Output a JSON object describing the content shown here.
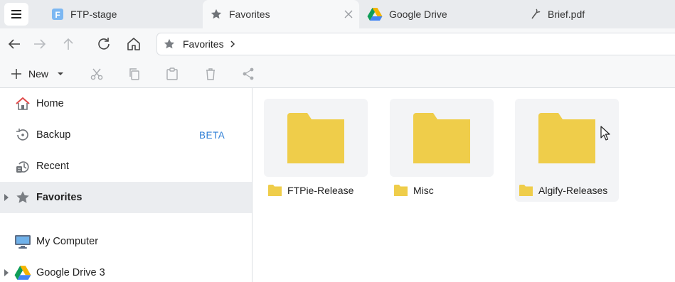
{
  "tabs": [
    {
      "label": "FTP-stage",
      "icon": "ftp-app-icon"
    },
    {
      "label": "Favorites",
      "icon": "star-icon",
      "active": true
    },
    {
      "label": "Google Drive",
      "icon": "google-drive-icon"
    },
    {
      "label": "Brief.pdf",
      "icon": "pdf-link-icon"
    }
  ],
  "address": {
    "path": [
      "Favorites"
    ]
  },
  "toolbar": {
    "new_label": "New"
  },
  "sidebar": {
    "items": [
      {
        "label": "Home",
        "icon": "home-icon"
      },
      {
        "label": "Backup",
        "icon": "backup-icon",
        "badge": "BETA"
      },
      {
        "label": "Recent",
        "icon": "recent-icon"
      },
      {
        "label": "Favorites",
        "icon": "star-icon",
        "selected": true
      },
      {
        "label": "My Computer",
        "icon": "computer-icon"
      },
      {
        "label": "Google Drive 3",
        "icon": "google-drive-icon"
      }
    ]
  },
  "folders": [
    {
      "name": "FTPie-Release"
    },
    {
      "name": "Misc"
    },
    {
      "name": "Algify-Releases"
    }
  ],
  "colors": {
    "folder": "#efcd4a",
    "accent": "#2f7fd6",
    "selected_bg": "#ebedf0"
  }
}
